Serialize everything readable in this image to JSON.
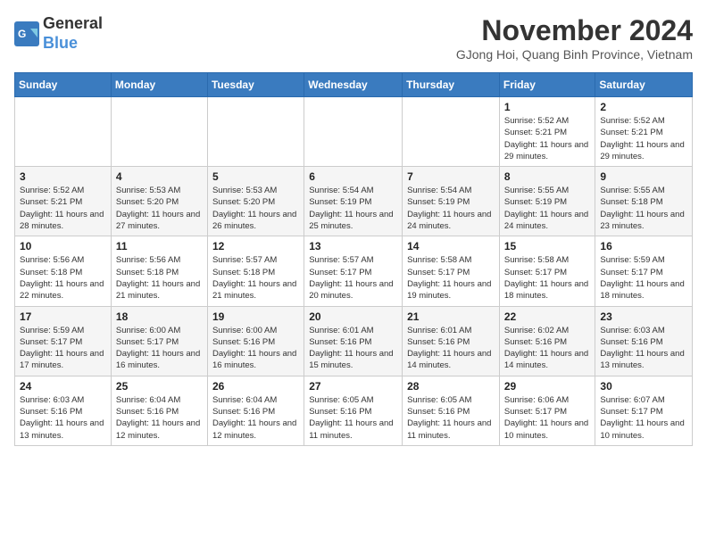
{
  "header": {
    "logo_line1": "General",
    "logo_line2": "Blue",
    "month_title": "November 2024",
    "subtitle": "GJong Hoi, Quang Binh Province, Vietnam"
  },
  "weekdays": [
    "Sunday",
    "Monday",
    "Tuesday",
    "Wednesday",
    "Thursday",
    "Friday",
    "Saturday"
  ],
  "weeks": [
    [
      {
        "day": "",
        "info": ""
      },
      {
        "day": "",
        "info": ""
      },
      {
        "day": "",
        "info": ""
      },
      {
        "day": "",
        "info": ""
      },
      {
        "day": "",
        "info": ""
      },
      {
        "day": "1",
        "info": "Sunrise: 5:52 AM\nSunset: 5:21 PM\nDaylight: 11 hours and 29 minutes."
      },
      {
        "day": "2",
        "info": "Sunrise: 5:52 AM\nSunset: 5:21 PM\nDaylight: 11 hours and 29 minutes."
      }
    ],
    [
      {
        "day": "3",
        "info": "Sunrise: 5:52 AM\nSunset: 5:21 PM\nDaylight: 11 hours and 28 minutes."
      },
      {
        "day": "4",
        "info": "Sunrise: 5:53 AM\nSunset: 5:20 PM\nDaylight: 11 hours and 27 minutes."
      },
      {
        "day": "5",
        "info": "Sunrise: 5:53 AM\nSunset: 5:20 PM\nDaylight: 11 hours and 26 minutes."
      },
      {
        "day": "6",
        "info": "Sunrise: 5:54 AM\nSunset: 5:19 PM\nDaylight: 11 hours and 25 minutes."
      },
      {
        "day": "7",
        "info": "Sunrise: 5:54 AM\nSunset: 5:19 PM\nDaylight: 11 hours and 24 minutes."
      },
      {
        "day": "8",
        "info": "Sunrise: 5:55 AM\nSunset: 5:19 PM\nDaylight: 11 hours and 24 minutes."
      },
      {
        "day": "9",
        "info": "Sunrise: 5:55 AM\nSunset: 5:18 PM\nDaylight: 11 hours and 23 minutes."
      }
    ],
    [
      {
        "day": "10",
        "info": "Sunrise: 5:56 AM\nSunset: 5:18 PM\nDaylight: 11 hours and 22 minutes."
      },
      {
        "day": "11",
        "info": "Sunrise: 5:56 AM\nSunset: 5:18 PM\nDaylight: 11 hours and 21 minutes."
      },
      {
        "day": "12",
        "info": "Sunrise: 5:57 AM\nSunset: 5:18 PM\nDaylight: 11 hours and 21 minutes."
      },
      {
        "day": "13",
        "info": "Sunrise: 5:57 AM\nSunset: 5:17 PM\nDaylight: 11 hours and 20 minutes."
      },
      {
        "day": "14",
        "info": "Sunrise: 5:58 AM\nSunset: 5:17 PM\nDaylight: 11 hours and 19 minutes."
      },
      {
        "day": "15",
        "info": "Sunrise: 5:58 AM\nSunset: 5:17 PM\nDaylight: 11 hours and 18 minutes."
      },
      {
        "day": "16",
        "info": "Sunrise: 5:59 AM\nSunset: 5:17 PM\nDaylight: 11 hours and 18 minutes."
      }
    ],
    [
      {
        "day": "17",
        "info": "Sunrise: 5:59 AM\nSunset: 5:17 PM\nDaylight: 11 hours and 17 minutes."
      },
      {
        "day": "18",
        "info": "Sunrise: 6:00 AM\nSunset: 5:17 PM\nDaylight: 11 hours and 16 minutes."
      },
      {
        "day": "19",
        "info": "Sunrise: 6:00 AM\nSunset: 5:16 PM\nDaylight: 11 hours and 16 minutes."
      },
      {
        "day": "20",
        "info": "Sunrise: 6:01 AM\nSunset: 5:16 PM\nDaylight: 11 hours and 15 minutes."
      },
      {
        "day": "21",
        "info": "Sunrise: 6:01 AM\nSunset: 5:16 PM\nDaylight: 11 hours and 14 minutes."
      },
      {
        "day": "22",
        "info": "Sunrise: 6:02 AM\nSunset: 5:16 PM\nDaylight: 11 hours and 14 minutes."
      },
      {
        "day": "23",
        "info": "Sunrise: 6:03 AM\nSunset: 5:16 PM\nDaylight: 11 hours and 13 minutes."
      }
    ],
    [
      {
        "day": "24",
        "info": "Sunrise: 6:03 AM\nSunset: 5:16 PM\nDaylight: 11 hours and 13 minutes."
      },
      {
        "day": "25",
        "info": "Sunrise: 6:04 AM\nSunset: 5:16 PM\nDaylight: 11 hours and 12 minutes."
      },
      {
        "day": "26",
        "info": "Sunrise: 6:04 AM\nSunset: 5:16 PM\nDaylight: 11 hours and 12 minutes."
      },
      {
        "day": "27",
        "info": "Sunrise: 6:05 AM\nSunset: 5:16 PM\nDaylight: 11 hours and 11 minutes."
      },
      {
        "day": "28",
        "info": "Sunrise: 6:05 AM\nSunset: 5:16 PM\nDaylight: 11 hours and 11 minutes."
      },
      {
        "day": "29",
        "info": "Sunrise: 6:06 AM\nSunset: 5:17 PM\nDaylight: 11 hours and 10 minutes."
      },
      {
        "day": "30",
        "info": "Sunrise: 6:07 AM\nSunset: 5:17 PM\nDaylight: 11 hours and 10 minutes."
      }
    ]
  ]
}
